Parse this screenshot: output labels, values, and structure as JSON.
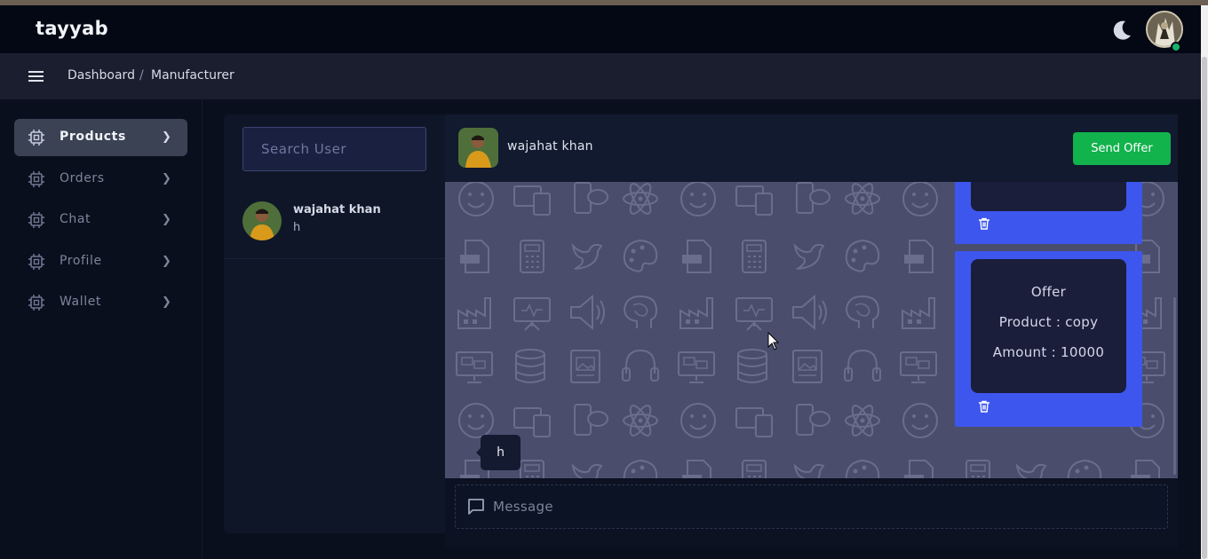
{
  "app": {
    "brand": "tayyab"
  },
  "header": {
    "theme_toggle_icon": "moon-icon",
    "avatar_icon": "user-avatar",
    "status_color": "#17b26a"
  },
  "breadcrumb": {
    "items": [
      "Dashboard",
      "Manufacturer"
    ],
    "separator": "/"
  },
  "sidebar": {
    "items": [
      {
        "label": "Products",
        "icon": "chip-icon",
        "active": true
      },
      {
        "label": "Orders",
        "icon": "chip-icon",
        "active": false
      },
      {
        "label": "Chat",
        "icon": "chip-icon",
        "active": false
      },
      {
        "label": "Profile",
        "icon": "chip-icon",
        "active": false
      },
      {
        "label": "Wallet",
        "icon": "chip-icon",
        "active": false
      }
    ]
  },
  "users": {
    "search_placeholder": "Search User",
    "list": [
      {
        "name": "wajahat khan",
        "last_message": "h"
      }
    ]
  },
  "chat": {
    "contact_name": "wajahat khan",
    "send_offer_label": "Send Offer",
    "incoming_message": "h",
    "offers": [
      {
        "title": "",
        "product": "",
        "amount": ""
      },
      {
        "title": "Offer",
        "product": "Product : copy",
        "amount": "Amount : 10000"
      }
    ],
    "composer_placeholder": "Message"
  },
  "colors": {
    "accent_green": "#12b24d",
    "offer_blue": "#3d56ee",
    "background": "#0a0f1e"
  }
}
